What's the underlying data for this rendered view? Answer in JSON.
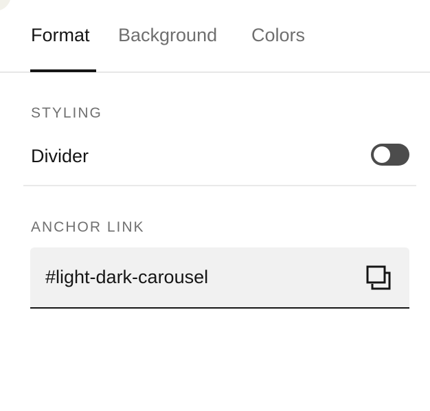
{
  "tabs": [
    {
      "label": "Format",
      "active": true
    },
    {
      "label": "Background",
      "active": false
    },
    {
      "label": "Colors",
      "active": false
    }
  ],
  "styling": {
    "section_label": "STYLING",
    "divider": {
      "label": "Divider",
      "enabled": false
    }
  },
  "anchor": {
    "section_label": "ANCHOR LINK",
    "value": "#light-dark-carousel",
    "copy_icon": "copy-icon"
  },
  "colors": {
    "active_text": "#151515",
    "inactive_text": "#6f6f6f",
    "toggle_off": "#4c4c4c",
    "field_background": "#f1f1f1"
  }
}
